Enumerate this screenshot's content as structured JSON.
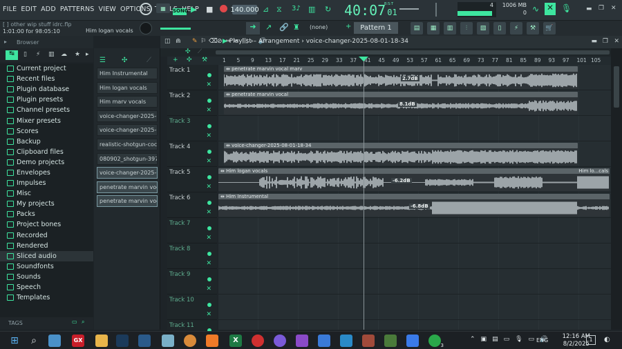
{
  "menu": [
    "FILE",
    "EDIT",
    "ADD",
    "PATTERNS",
    "VIEW",
    "OPTIONS",
    "TOOLS",
    "HELP"
  ],
  "project": {
    "file": "[ ] other wip stuff idrc.flp",
    "time_hint": "1:01:00 for 98:05:10",
    "hint_name": "Him logan vocals"
  },
  "transport": {
    "tempo": "140.000",
    "song_label": "SONG",
    "time": "40:07",
    "time_sub": "01",
    "time_small": "B:S:T"
  },
  "cpu": {
    "value": "4",
    "mem": "1006 MB",
    "poly": "0"
  },
  "pattern": {
    "none": "(none)",
    "name": "Pattern 1"
  },
  "browser": {
    "title": "Browser",
    "items": [
      "Current project",
      "Recent files",
      "Plugin database",
      "Plugin presets",
      "Channel presets",
      "Mixer presets",
      "Scores",
      "Backup",
      "Clipboard files",
      "Demo projects",
      "Envelopes",
      "Impulses",
      "Misc",
      "My projects",
      "Packs",
      "Project bones",
      "Recorded",
      "Rendered",
      "Sliced audio",
      "Soundfonts",
      "Sounds",
      "Speech",
      "Templates"
    ],
    "selected": "Sliced audio",
    "tags": "TAGS"
  },
  "picker": [
    "Him Instrumental",
    "Him logan vocals",
    "Him marv vocals",
    "voice-changer-2025-07-...",
    "voice-changer-2025-07-...",
    "realistic-shotgun-cockin...",
    "080902_shotgun-39753",
    "voice-changer-2025-08-...",
    "penetrate marvin vocal",
    "penetrate marvin vocal..."
  ],
  "playlist": {
    "breadcrumb": "Playlist – Arrangement",
    "arrangement": "voice-changer-2025-08-01-18-34"
  },
  "ruler": [
    "1",
    "5",
    "9",
    "13",
    "17",
    "21",
    "25",
    "29",
    "33",
    "37",
    "41",
    "45",
    "49",
    "53",
    "57",
    "61",
    "65",
    "69",
    "73",
    "77",
    "81",
    "85",
    "89",
    "93",
    "97",
    "101",
    "105"
  ],
  "tracks": [
    "Track 1",
    "Track 2",
    "Track 3",
    "Track 4",
    "Track 5",
    "Track 6",
    "Track 7",
    "Track 8",
    "Track 9",
    "Track 10",
    "Track 11"
  ],
  "clips": [
    {
      "track": 0,
      "title": "penetrate marvin vocal marv",
      "gain": "2.7dB"
    },
    {
      "track": 1,
      "title": "penetrate marvin vocal",
      "gain": "8.1dB"
    },
    {
      "track": 3,
      "title": "voice-changer-2025-08-01-18-34",
      "gain": ""
    },
    {
      "track": 4,
      "title": "Him logan vocals",
      "gain": "-6.2dB",
      "end_title": "Him lo...cals"
    },
    {
      "track": 5,
      "title": "Him Instrumental",
      "gain": "-6.8dB"
    }
  ],
  "taskbar": {
    "time": "12:16 AM",
    "date": "8/2/2025",
    "lang": "ENG",
    "notif": "1",
    "whatsapp_badge": "3"
  }
}
